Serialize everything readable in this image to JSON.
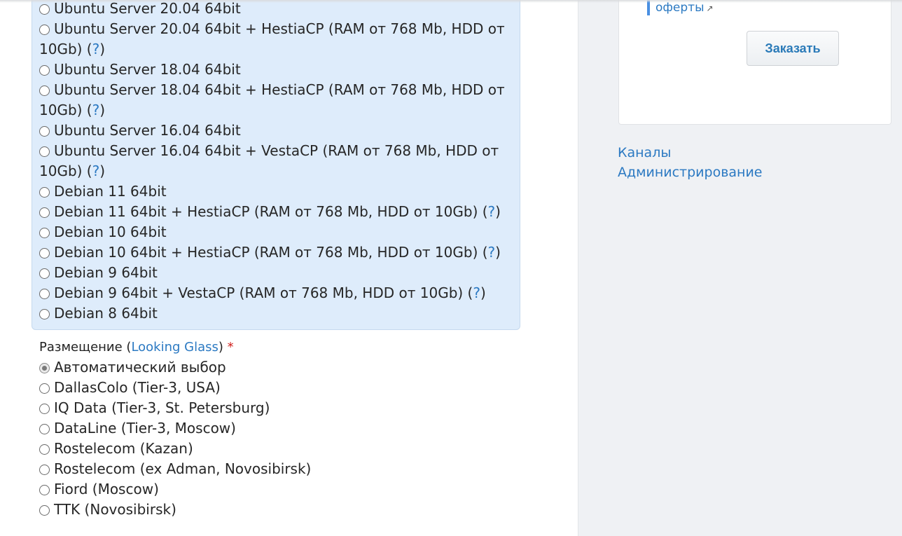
{
  "os_options": [
    {
      "label": "Ubuntu Server 20.04 64bit",
      "checked": false
    },
    {
      "label": "Ubuntu Server 20.04 64bit + HestiaCP (RAM от 768 Mb, HDD от",
      "cont": "10Gb) (",
      "help": "?",
      "close": ")",
      "checked": false
    },
    {
      "label": "Ubuntu Server 18.04 64bit",
      "checked": false
    },
    {
      "label": "Ubuntu Server 18.04 64bit + HestiaCP (RAM от 768 Mb, HDD от",
      "cont": "10Gb) (",
      "help": "?",
      "close": ")",
      "checked": false
    },
    {
      "label": "Ubuntu Server 16.04 64bit",
      "checked": false
    },
    {
      "label": "Ubuntu Server 16.04 64bit + VestaCP (RAM от 768 Mb, HDD от",
      "cont": "10Gb) (",
      "help": "?",
      "close": ")",
      "checked": false
    },
    {
      "label": "Debian 11 64bit",
      "checked": false
    },
    {
      "label": "Debian 11 64bit + HestiaCP (RAM от 768 Mb, HDD от 10Gb) (",
      "help": "?",
      "close": ")",
      "checked": false
    },
    {
      "label": "Debian 10 64bit",
      "checked": false
    },
    {
      "label": "Debian 10 64bit + HestiaCP (RAM от 768 Mb, HDD от 10Gb) (",
      "help": "?",
      "close": ")",
      "checked": false
    },
    {
      "label": "Debian 9 64bit",
      "checked": false
    },
    {
      "label": "Debian 9 64bit + VestaCP (RAM от 768 Mb, HDD от 10Gb) (",
      "help": "?",
      "close": ")",
      "checked": false
    },
    {
      "label": "Debian 8 64bit",
      "checked": false
    }
  ],
  "placement": {
    "label": "Размещение (",
    "link": "Looking Glass",
    "close": ")",
    "required": "*",
    "options": [
      {
        "label": "Автоматический выбор",
        "checked": true
      },
      {
        "label": "DallasColo (Tier-3, USA)",
        "checked": false
      },
      {
        "label": "IQ Data (Tier-3, St. Petersburg)",
        "checked": false
      },
      {
        "label": "DataLine (Tier-3, Moscow)",
        "checked": false
      },
      {
        "label": "Rostelecom (Kazan)",
        "checked": false
      },
      {
        "label": "Rostelecom (ex Adman, Novosibirsk)",
        "checked": false
      },
      {
        "label": "Fiord (Moscow)",
        "checked": false
      },
      {
        "label": "TTK (Novosibirsk)",
        "checked": false
      }
    ]
  },
  "sidebar": {
    "offer_link": "оферты",
    "offer_icon": "external-link-icon",
    "order_button": "Заказать",
    "links": [
      "Каналы",
      "Администрирование"
    ]
  },
  "colors": {
    "link": "#2b79c2",
    "required": "#d0201c",
    "os_box_bg": "#deecfb",
    "sidebar_bg": "#eff1f4"
  }
}
